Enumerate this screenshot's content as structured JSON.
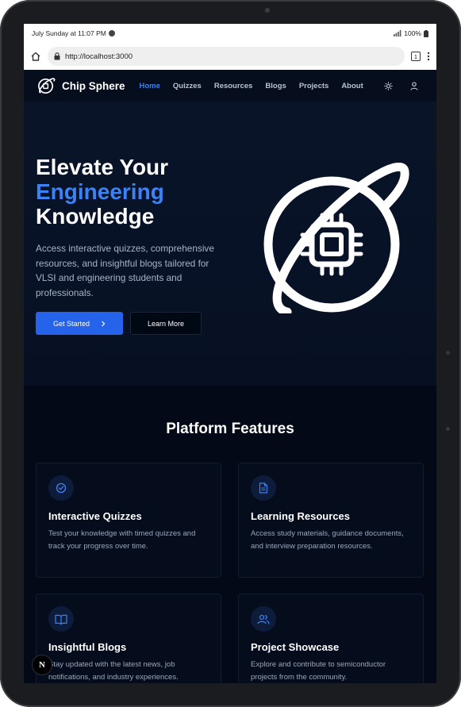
{
  "status_bar": {
    "time": "July Sunday at 11:07 PM",
    "battery": "100%"
  },
  "browser": {
    "url": "http://localhost:3000",
    "tab_count": "1"
  },
  "nav": {
    "brand": "Chip Sphere",
    "links": [
      {
        "label": "Home",
        "active": true
      },
      {
        "label": "Quizzes"
      },
      {
        "label": "Resources"
      },
      {
        "label": "Blogs"
      },
      {
        "label": "Projects"
      },
      {
        "label": "About"
      }
    ]
  },
  "hero": {
    "title_line1": "Elevate Your",
    "title_accent": "Engineering",
    "title_line3": "Knowledge",
    "description": "Access interactive quizzes, comprehensive resources, and insightful blogs tailored for VLSI and engineering students and professionals.",
    "primary_button": "Get Started",
    "secondary_button": "Learn More"
  },
  "features": {
    "title": "Platform Features",
    "cards": [
      {
        "icon": "check-circle-icon",
        "title": "Interactive Quizzes",
        "description": "Test your knowledge with timed quizzes and track your progress over time."
      },
      {
        "icon": "document-icon",
        "title": "Learning Resources",
        "description": "Access study materials, guidance documents, and interview preparation resources."
      },
      {
        "icon": "book-open-icon",
        "title": "Insightful Blogs",
        "description": "Stay updated with the latest news, job notifications, and industry experiences."
      },
      {
        "icon": "users-icon",
        "title": "Project Showcase",
        "description": "Explore and contribute to semiconductor projects from the community."
      }
    ]
  },
  "dev_badge": "N",
  "colors": {
    "accent": "#3b82f6",
    "primary_button": "#2563eb",
    "background": "#030a17"
  }
}
